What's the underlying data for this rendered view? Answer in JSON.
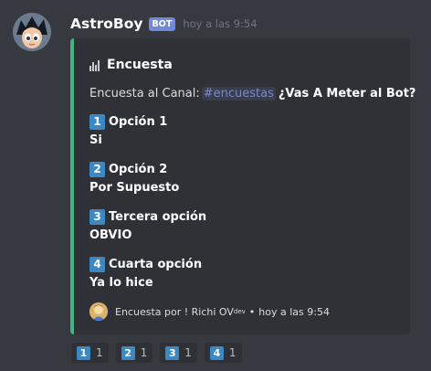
{
  "message": {
    "username": "AstroBoy",
    "bot_tag": "BOT",
    "timestamp": "hoy a las 9:54"
  },
  "embed": {
    "accent_color": "#43b581",
    "title_icon": "bar-chart-icon",
    "title": "Encuesta",
    "description_prefix": "Encuesta al Canal:",
    "channel_mention": "#encuestas",
    "question": "¿Vas A Meter al Bot?",
    "fields": [
      {
        "number": "1",
        "name": "Opción 1",
        "value": "Si"
      },
      {
        "number": "2",
        "name": "Opción 2",
        "value": "Por Supuesto"
      },
      {
        "number": "3",
        "name": "Tercera opción",
        "value": "OBVIO"
      },
      {
        "number": "4",
        "name": "Cuarta opción",
        "value": "Ya lo hice"
      }
    ],
    "footer": {
      "text": "Encuesta por ! Richi OV",
      "superscript": "dev",
      "separator": "•",
      "timestamp": "hoy a las 9:54"
    }
  },
  "reactions": [
    {
      "emoji": "1",
      "count": "1"
    },
    {
      "emoji": "2",
      "count": "1"
    },
    {
      "emoji": "3",
      "count": "1"
    },
    {
      "emoji": "4",
      "count": "1"
    }
  ]
}
